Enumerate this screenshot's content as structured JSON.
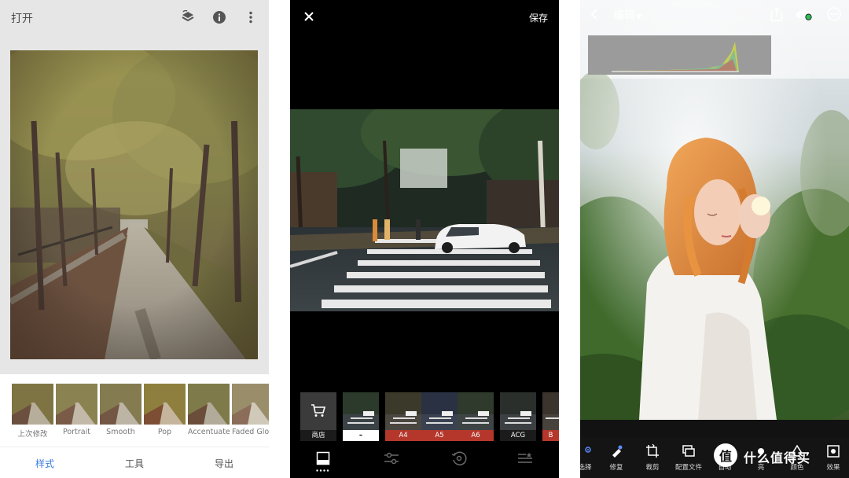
{
  "snapseed": {
    "open_label": "打开",
    "icons": [
      "undo-layers-icon",
      "info-icon",
      "more-vertical-icon"
    ],
    "filters": [
      {
        "label": "上次修改"
      },
      {
        "label": "Portrait"
      },
      {
        "label": "Smooth"
      },
      {
        "label": "Pop"
      },
      {
        "label": "Accentuate"
      },
      {
        "label": "Faded Glow"
      }
    ],
    "tabs": [
      {
        "label": "样式",
        "active": true
      },
      {
        "label": "工具",
        "active": false
      },
      {
        "label": "导出",
        "active": false
      }
    ],
    "colors": {
      "active_tab": "#3b7fe0",
      "background": "#e6e6e6"
    }
  },
  "vsco": {
    "save_label": "保存",
    "shop_label": "商店",
    "presets": [
      {
        "label": "–"
      },
      {
        "label": "A4"
      },
      {
        "label": "A5"
      },
      {
        "label": "A6"
      },
      {
        "label": "ACG"
      },
      {
        "label": "B"
      }
    ],
    "bottom_icons": [
      "presets-icon",
      "adjust-sliders-icon",
      "history-icon",
      "recipes-icon"
    ],
    "colors": {
      "preset_label": "#b5372b"
    }
  },
  "lightroom": {
    "title": "编辑",
    "icons": [
      "back-icon",
      "share-icon",
      "cloud-sync-icon",
      "more-icon"
    ],
    "tools": [
      {
        "label": "选择"
      },
      {
        "label": "修复"
      },
      {
        "label": "裁剪"
      },
      {
        "label": "配置文件"
      },
      {
        "label": "自动"
      },
      {
        "label": "亮"
      },
      {
        "label": "颜色"
      },
      {
        "label": "效果"
      }
    ],
    "watermark": {
      "text": "什么值得买",
      "logo_char": "值"
    },
    "colors": {
      "cloud_status": "#2dbf5a"
    }
  }
}
